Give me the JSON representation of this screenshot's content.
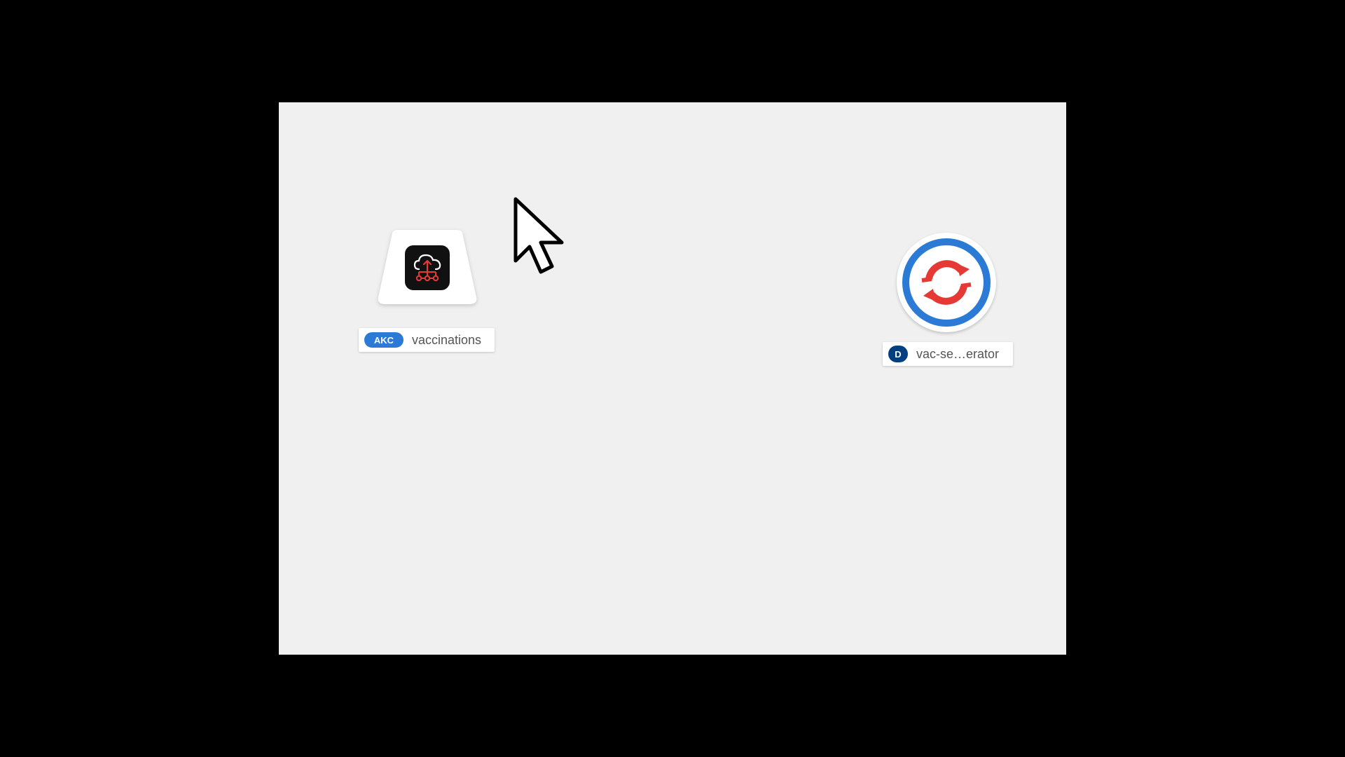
{
  "topology": {
    "nodes": [
      {
        "kind": "kafka-connection",
        "badge": "AKC",
        "name": "vaccinations",
        "icon": "cloud-upload-network-icon",
        "badge_color": "#2b7bd6"
      },
      {
        "kind": "deployment",
        "badge": "D",
        "name": "vac-se…erator",
        "icon": "openshift-logo-icon",
        "badge_color": "#004080",
        "ring_color": "#2b7bd6",
        "logo_color": "#e53935"
      }
    ]
  },
  "colors": {
    "canvas_bg": "#f0f0f0",
    "frame_bg": "#000000"
  }
}
